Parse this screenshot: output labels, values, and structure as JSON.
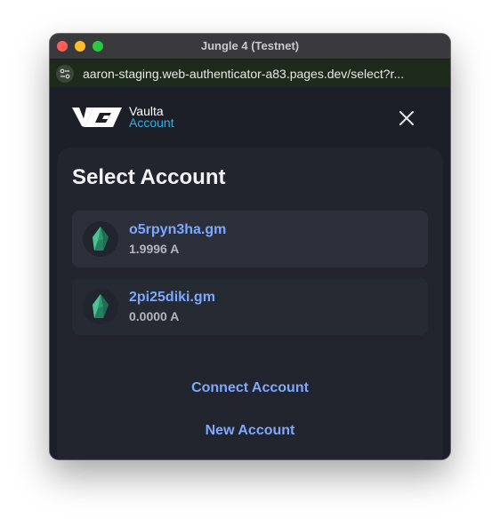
{
  "window": {
    "title": "Jungle 4 (Testnet)",
    "url": "aaron-staging.web-authenticator-a83.pages.dev/select?r..."
  },
  "brand": {
    "name_line1": "Vaulta",
    "name_line2": "Account",
    "accent_color": "#2fb0e6"
  },
  "icons": {
    "close": "close-icon",
    "site_settings": "site-settings-icon",
    "account_avatar": "crystal-icon"
  },
  "main": {
    "title": "Select Account",
    "accounts": [
      {
        "name": "o5rpyn3ha.gm",
        "balance": "1.9996 A"
      },
      {
        "name": "2pi25diki.gm",
        "balance": "0.0000 A"
      }
    ],
    "connect_label": "Connect Account",
    "new_label": "New Account"
  },
  "colors": {
    "background": "#1c1f27",
    "card": "#22252e",
    "link": "#7da8ff",
    "avatar_crystal": "#2f9a72"
  }
}
